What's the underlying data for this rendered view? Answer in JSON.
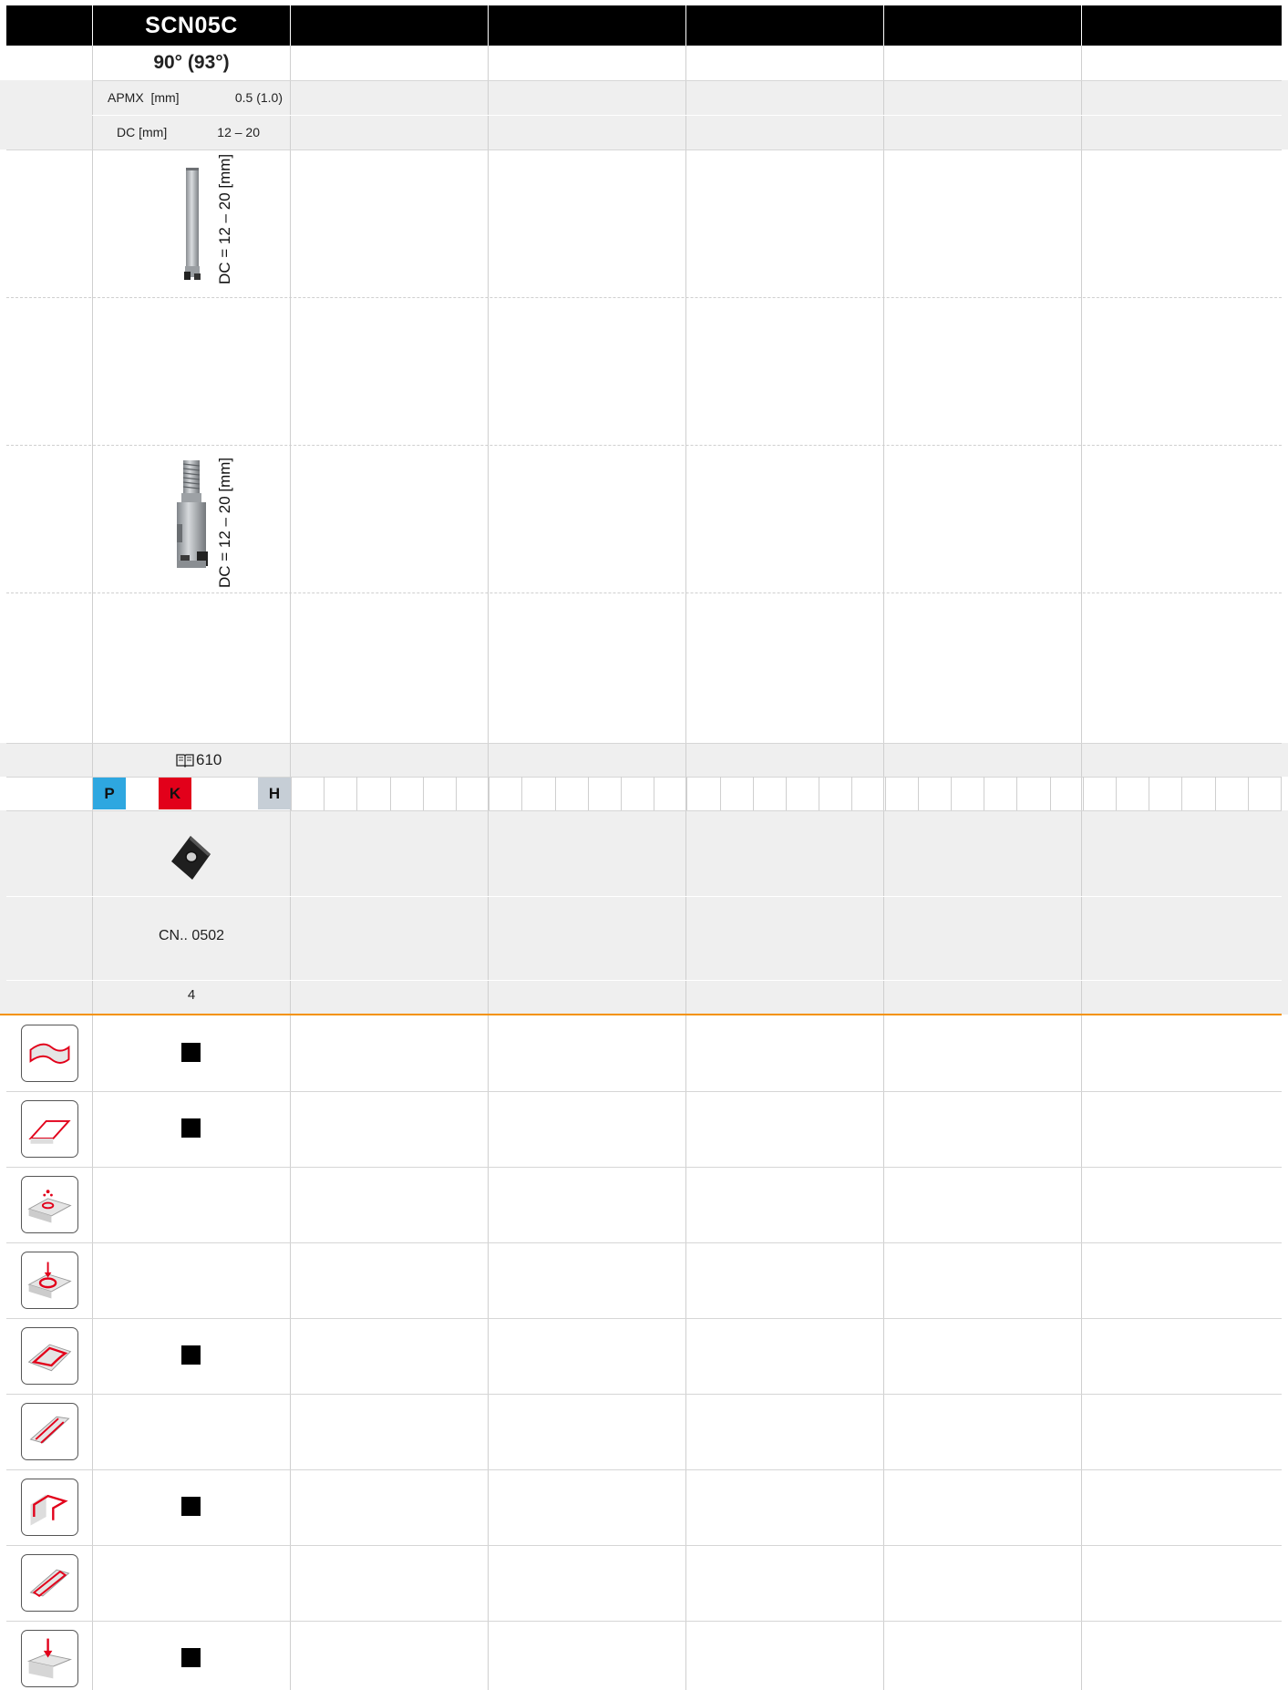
{
  "header": {
    "tool_name": "SCN05C",
    "angle": "90° (93°)",
    "apmx_label": "APMX  [mm]",
    "apmx_value": "0.5 (1.0)",
    "dc_label": "DC [mm]",
    "dc_value": "12 – 20"
  },
  "tool_images": [
    {
      "icon": "end-mill-cylindrical-shank-image",
      "dimension_label": "DC = 12 – 20 [mm]"
    },
    {
      "icon": "end-mill-screw-in-head-image",
      "dimension_label": "DC = 12 – 20 [mm]"
    }
  ],
  "page_reference": {
    "icon": "book-icon",
    "page": "610"
  },
  "materials": [
    {
      "label": "P",
      "color": "#2ea7e0"
    },
    {
      "label": "K",
      "color": "#e2001a"
    },
    {
      "label": "H",
      "color": "#c6ced6"
    }
  ],
  "insert": {
    "icon": "square-insert-image",
    "designation": "CN.. 0502",
    "cutting_edges": "4"
  },
  "applications": [
    {
      "icon": "face-milling-contour-icon",
      "supported": true
    },
    {
      "icon": "face-milling-icon",
      "supported": true
    },
    {
      "icon": "helical-drilling-icon",
      "supported": false
    },
    {
      "icon": "circular-interpolation-icon",
      "supported": false
    },
    {
      "icon": "ramping-pocket-icon",
      "supported": true
    },
    {
      "icon": "slot-milling-icon",
      "supported": false
    },
    {
      "icon": "shoulder-milling-icon",
      "supported": true
    },
    {
      "icon": "edge-chamfer-icon",
      "supported": false
    },
    {
      "icon": "plunge-milling-icon",
      "supported": true
    }
  ],
  "colors": {
    "header_background": "#000000",
    "accent_orange": "#f39200",
    "row_grey": "#efefef"
  }
}
